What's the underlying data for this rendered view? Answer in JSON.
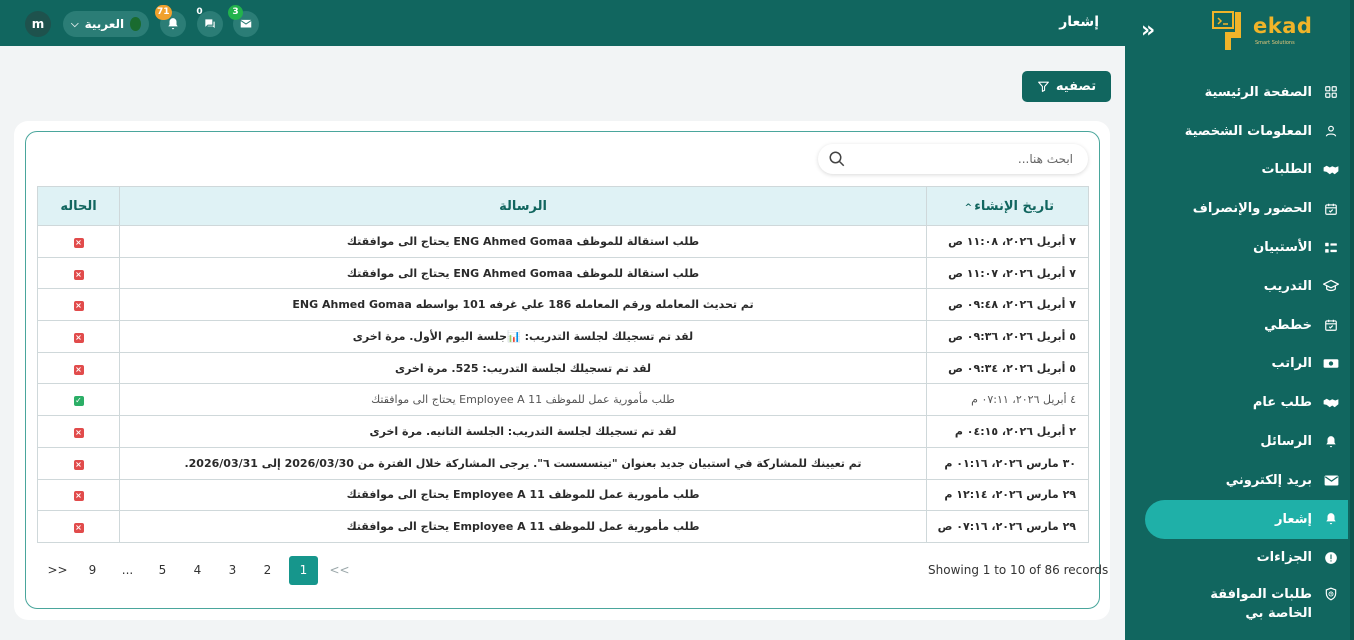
{
  "header": {
    "title": "إشعار",
    "user_initial": "m",
    "language": "العربية",
    "badges": {
      "notifications": "71",
      "messages": "0",
      "mail": "3"
    }
  },
  "sidebar": {
    "logo_text": "ekad",
    "logo_sub": "Smart Solutions",
    "items": [
      {
        "label": "الصفحة الرئيسية",
        "icon": "grid-icon"
      },
      {
        "label": "المعلومات الشخصية",
        "icon": "user-icon"
      },
      {
        "label": "الطلبات",
        "icon": "handshake-icon"
      },
      {
        "label": "الحضور والإنصراف",
        "icon": "calendar-check-icon"
      },
      {
        "label": "الأستبيان",
        "icon": "survey-icon"
      },
      {
        "label": "التدريب",
        "icon": "graduation-cap-icon"
      },
      {
        "label": "خططي",
        "icon": "calendar-check-icon"
      },
      {
        "label": "الراتب",
        "icon": "money-icon"
      },
      {
        "label": "طلب عام",
        "icon": "handshake-icon"
      },
      {
        "label": "الرسائل",
        "icon": "bell-icon"
      },
      {
        "label": "بريد إلكتروني",
        "icon": "envelope-icon"
      },
      {
        "label": "إشعار",
        "icon": "bell-icon",
        "active": true
      },
      {
        "label": "الجزاءات",
        "icon": "alert-circle-icon"
      },
      {
        "label": "طلبات الموافقة الخاصة بي",
        "icon": "shield-clock-icon"
      }
    ]
  },
  "toolbar": {
    "filter_label": "تصفيه"
  },
  "search": {
    "placeholder": "ابحث هنا..."
  },
  "table": {
    "columns": {
      "date": "تاريخ الإنشاء",
      "message": "الرسالة",
      "status": "الحاله"
    },
    "rows": [
      {
        "date": "٧ أبريل ٢٠٢٦، ١١:٠٨ ص",
        "message": "طلب استقالة للموظف ENG Ahmed Gomaa يحتاج الى موافقتك",
        "status": "rejected",
        "read": false
      },
      {
        "date": "٧ أبريل ٢٠٢٦، ١١:٠٧ ص",
        "message": "طلب استقالة للموظف ENG Ahmed Gomaa يحتاج الى موافقتك",
        "status": "rejected",
        "read": false
      },
      {
        "date": "٧ أبريل ٢٠٢٦، ٠٩:٤٨ ص",
        "message": "تم تحديث المعامله ورقم المعامله 186 علي غرفه 101 بواسطه ENG Ahmed Gomaa",
        "status": "rejected",
        "read": false
      },
      {
        "date": "٥ أبريل ٢٠٢٦، ٠٩:٣٦ ص",
        "message": "لقد تم تسجيلك لجلسة التدريب: 📊جلسة اليوم الأول. مرة اخرى",
        "status": "rejected",
        "read": false
      },
      {
        "date": "٥ أبريل ٢٠٢٦، ٠٩:٣٤ ص",
        "message": "لقد تم تسجيلك لجلسة التدريب: 525. مرة اخرى",
        "status": "rejected",
        "read": false
      },
      {
        "date": "٤ أبريل ٢٠٢٦، ٠٧:١١ م",
        "message": "طلب مأمورية عمل للموظف Employee A 11 يحتاج الى موافقتك",
        "status": "approved",
        "read": true
      },
      {
        "date": "٢ أبريل ٢٠٢٦، ٠٤:١٥ م",
        "message": "لقد تم تسجيلك لجلسة التدريب: الجلسة التانيه. مرة اخرى",
        "status": "rejected",
        "read": false
      },
      {
        "date": "٣٠ مارس ٢٠٢٦، ٠١:١٦ م",
        "message": "تم تعيينك للمشاركة في استبيان جديد بعنوان \"تيتسسست ٦\". يرجى المشاركة خلال الفترة من 2026/03/30 إلى 2026/03/31.",
        "status": "rejected",
        "read": false
      },
      {
        "date": "٢٩ مارس ٢٠٢٦، ١٢:١٤ م",
        "message": "طلب مأمورية عمل للموظف Employee A 11 يحتاج الى موافقتك",
        "status": "rejected",
        "read": false
      },
      {
        "date": "٢٩ مارس ٢٠٢٦، ٠٧:١٦ ص",
        "message": "طلب مأمورية عمل للموظف Employee A 11 يحتاج الى موافقتك",
        "status": "rejected",
        "read": false
      }
    ]
  },
  "pagination": {
    "records_text": "Showing 1 to 10 of 86 records",
    "pages": [
      ">>",
      "9",
      "...",
      "5",
      "4",
      "3",
      "2",
      "1",
      "<<"
    ],
    "current": "1"
  },
  "colors": {
    "primary": "#11665f",
    "accent": "#1fb0a8",
    "header_cell": "#dff2f5",
    "danger": "#e14b4b",
    "success": "#2bae66"
  }
}
